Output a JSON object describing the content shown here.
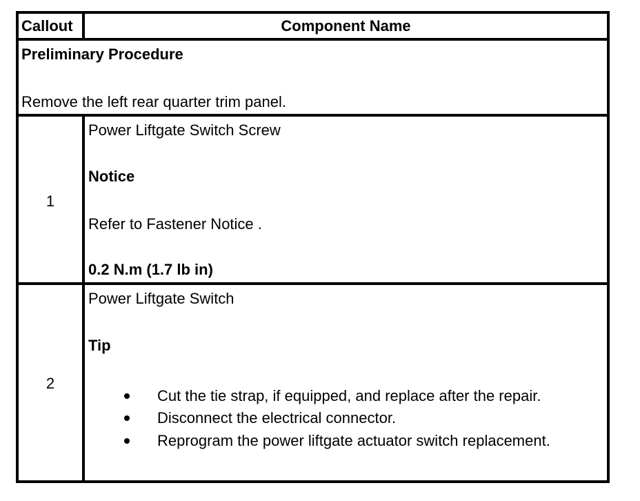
{
  "header": {
    "callout": "Callout",
    "component_name": "Component Name"
  },
  "preliminary": {
    "title": "Preliminary Procedure",
    "text": "Remove the left rear quarter trim panel."
  },
  "rows": [
    {
      "callout": "1",
      "component": "Power Liftgate Switch Screw",
      "notice_label": "Notice",
      "notice_text": "Refer to Fastener Notice .",
      "torque": "0.2 N.m (1.7 lb in)"
    },
    {
      "callout": "2",
      "component": "Power Liftgate Switch",
      "tip_label": "Tip",
      "tips": [
        "Cut the tie strap, if equipped, and replace after the repair.",
        "Disconnect the electrical connector.",
        "Reprogram the power liftgate actuator switch replacement."
      ]
    }
  ]
}
